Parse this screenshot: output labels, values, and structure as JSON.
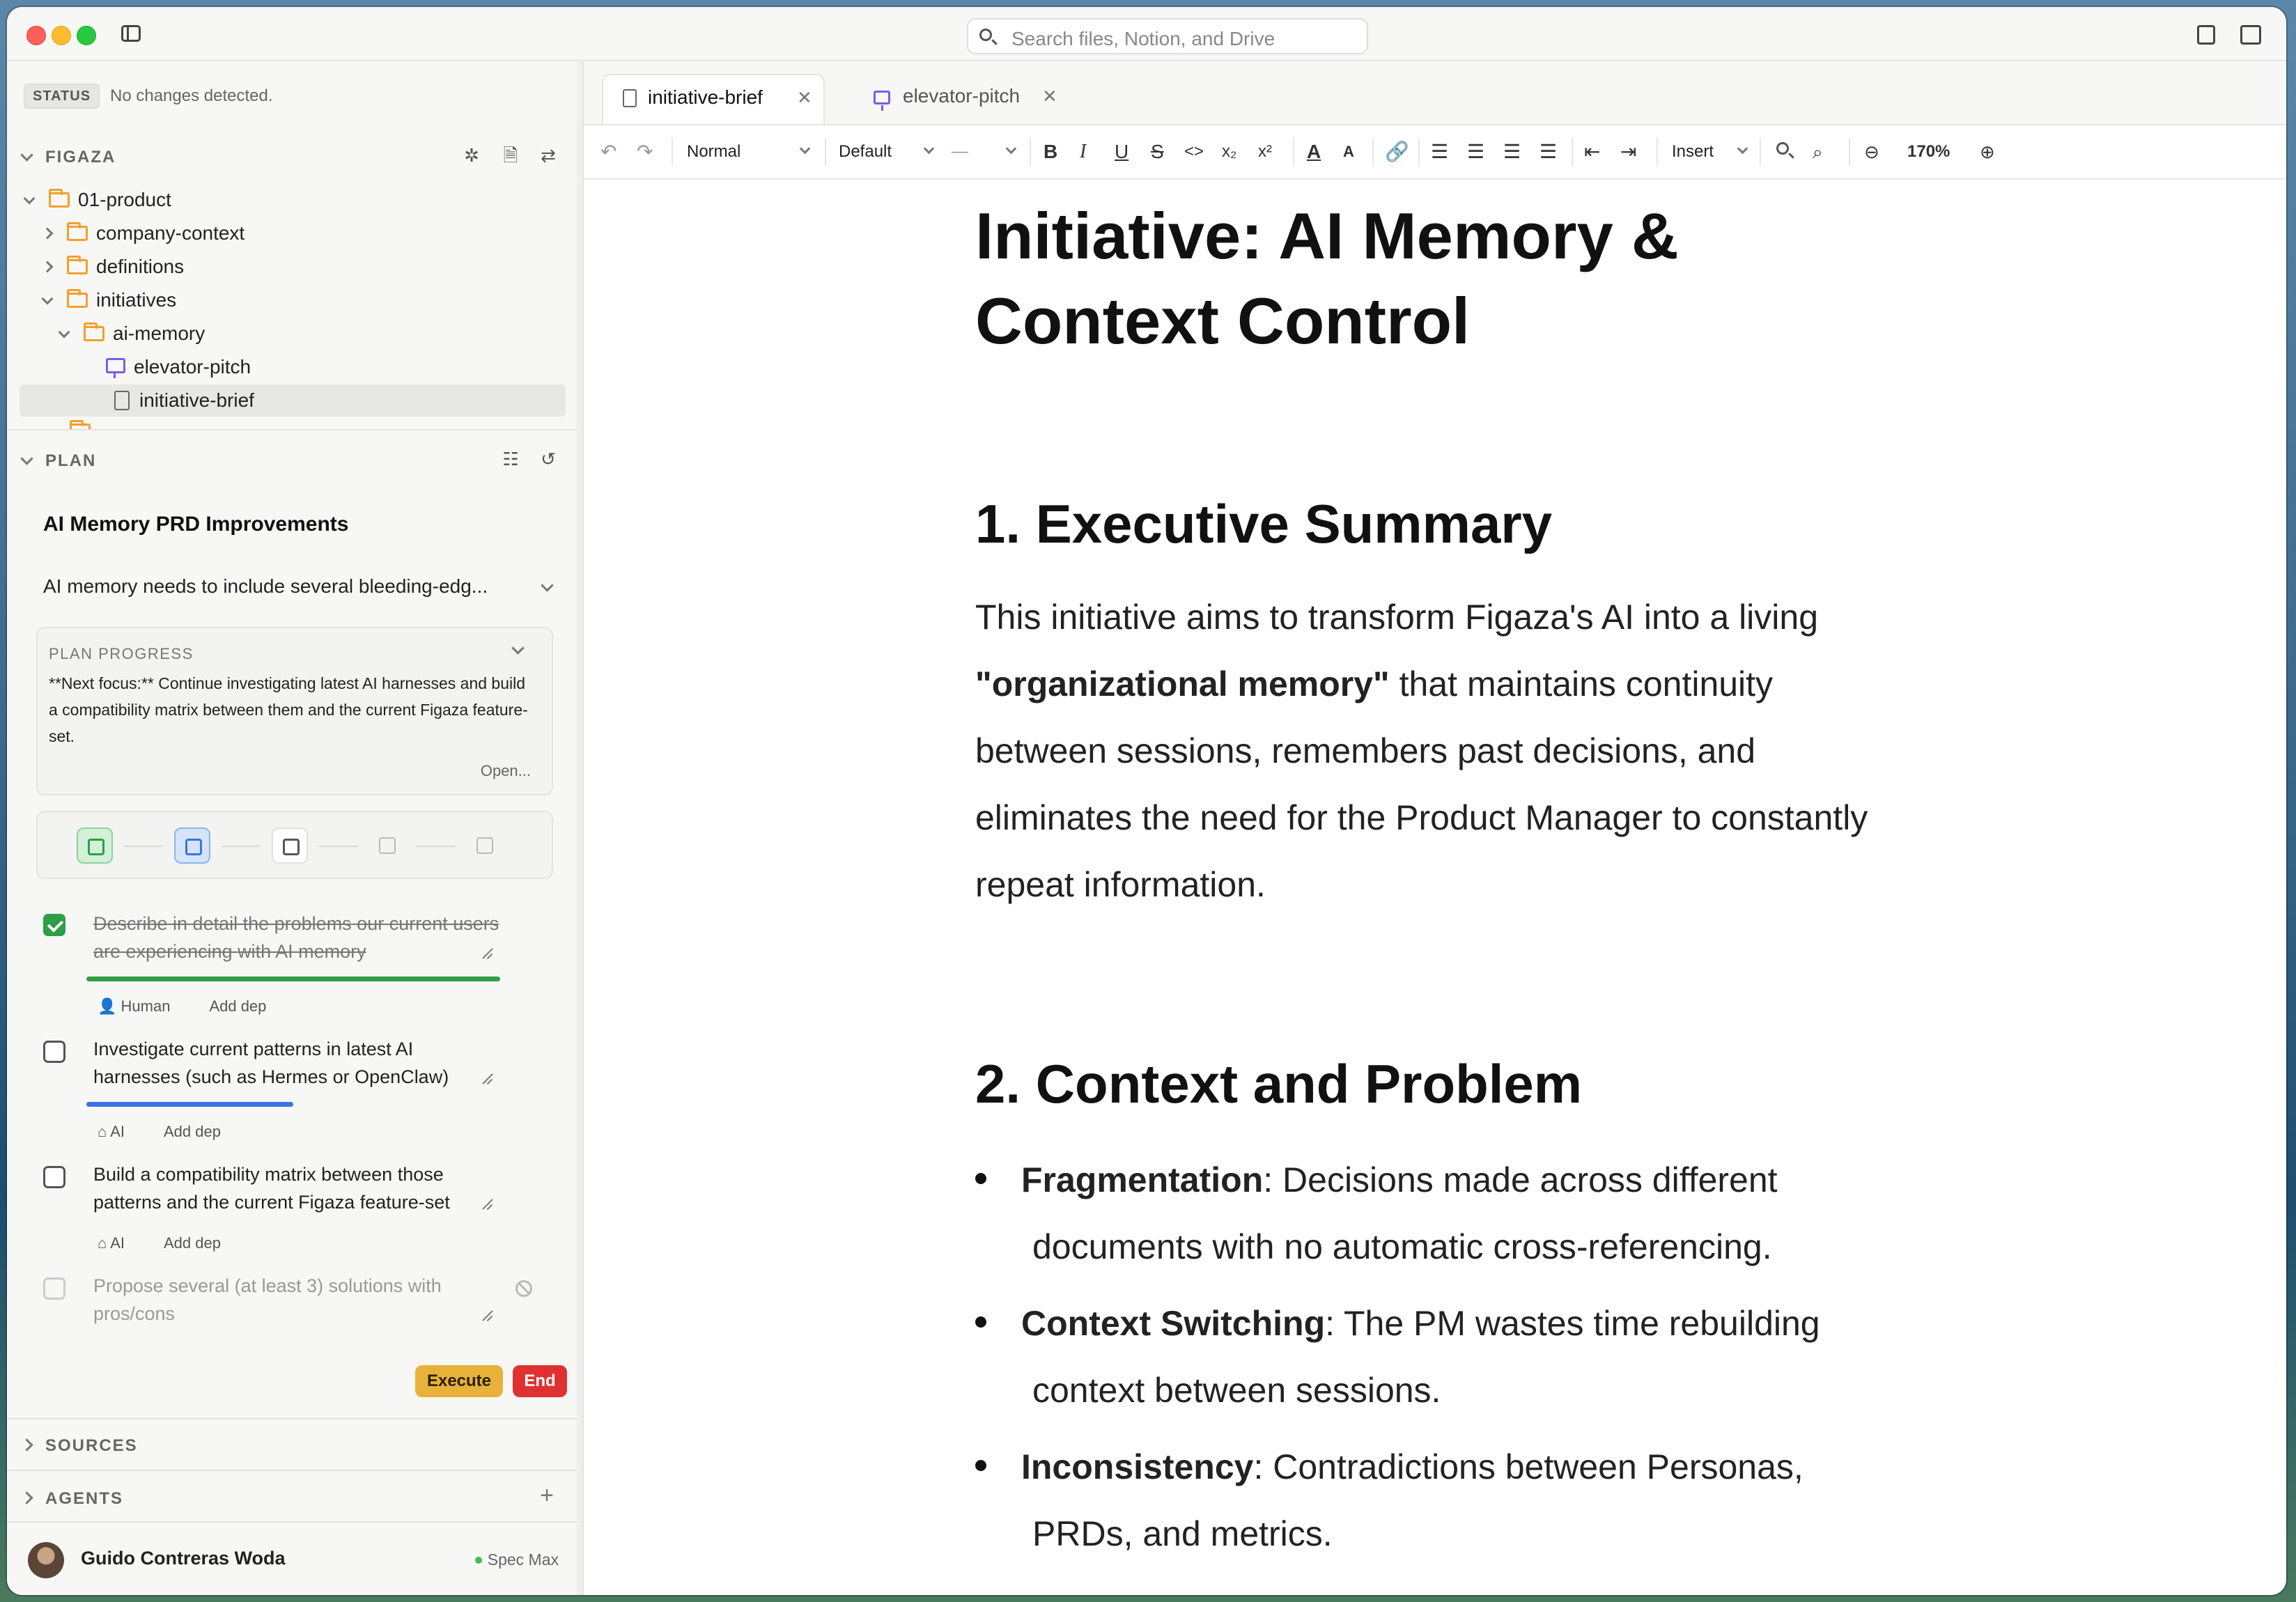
{
  "window": {
    "search_placeholder": "Search files, Notion, and Drive"
  },
  "sidebar": {
    "status": {
      "badge": "STATUS",
      "text": "No changes detected."
    },
    "workspace": {
      "title": "FIGAZA",
      "tree": [
        {
          "label": "01-product",
          "type": "folder",
          "expanded": true
        },
        {
          "label": "company-context",
          "type": "folder",
          "expanded": false
        },
        {
          "label": "definitions",
          "type": "folder",
          "expanded": false
        },
        {
          "label": "initiatives",
          "type": "folder",
          "expanded": true
        },
        {
          "label": "ai-memory",
          "type": "folder",
          "expanded": true
        },
        {
          "label": "elevator-pitch",
          "type": "presentation"
        },
        {
          "label": "initiative-brief",
          "type": "document",
          "selected": true
        }
      ]
    },
    "plan": {
      "section_title": "PLAN",
      "title": "AI Memory PRD Improvements",
      "summary": "AI memory needs to include several bleeding-edg...",
      "progress": {
        "label": "PLAN PROGRESS",
        "text": "**Next focus:** Continue investigating latest AI harnesses and build a compatibility matrix between them and the current Figaza feature-set.",
        "open_label": "Open..."
      },
      "steps": [
        "done",
        "active",
        "pending",
        "disabled",
        "disabled"
      ],
      "tasks": [
        {
          "text": "Describe in detail the problems our current users are experiencing with AI memory",
          "state": "done",
          "progress": 1.0,
          "owner": "Human",
          "dep": "Add dep",
          "color": "#2f9e44"
        },
        {
          "text": "Investigate current patterns in latest AI harnesses (such as Hermes or OpenClaw)",
          "state": "open",
          "progress": 0.5,
          "owner": "AI",
          "dep": "Add dep",
          "color": "#3b73e0"
        },
        {
          "text": "Build a compatibility matrix between those patterns and the current Figaza feature-set",
          "state": "open",
          "owner": "AI",
          "dep": "Add dep"
        },
        {
          "text": "Propose several (at least 3) solutions with pros/cons",
          "state": "disabled"
        }
      ],
      "execute_label": "Execute",
      "end_label": "End"
    },
    "sources_title": "SOURCES",
    "agents_title": "AGENTS",
    "user": {
      "name": "Guido Contreras Woda",
      "plan": "Spec Max"
    }
  },
  "editor": {
    "tabs": [
      {
        "label": "initiative-brief",
        "active": true
      },
      {
        "label": "elevator-pitch",
        "active": false
      }
    ],
    "toolbar": {
      "block_style": "Normal",
      "font": "Default",
      "size": "—",
      "insert_label": "Insert",
      "zoom": "170%"
    },
    "document": {
      "title": "Initiative: AI Memory & Context Control",
      "section1": {
        "heading": "1. Executive Summary",
        "p_before": "This initiative aims to transform Figaza's AI into a living ",
        "p_bold": "\"organizational memory\"",
        "p_after": " that maintains continuity between sessions, remembers past decisions, and eliminates the need for the Product Manager to constantly repeat information."
      },
      "section2": {
        "heading": "2. Context and Problem",
        "bullets": [
          {
            "term": "Fragmentation",
            "line1": ": Decisions made across different",
            "line2": "documents with no automatic cross-referencing."
          },
          {
            "term": "Context Switching",
            "line1": ": The PM wastes time rebuilding",
            "line2": "context between sessions."
          },
          {
            "term": "Inconsistency",
            "line1": ": Contradictions between Personas,",
            "line2": "PRDs, and metrics."
          }
        ]
      }
    }
  }
}
